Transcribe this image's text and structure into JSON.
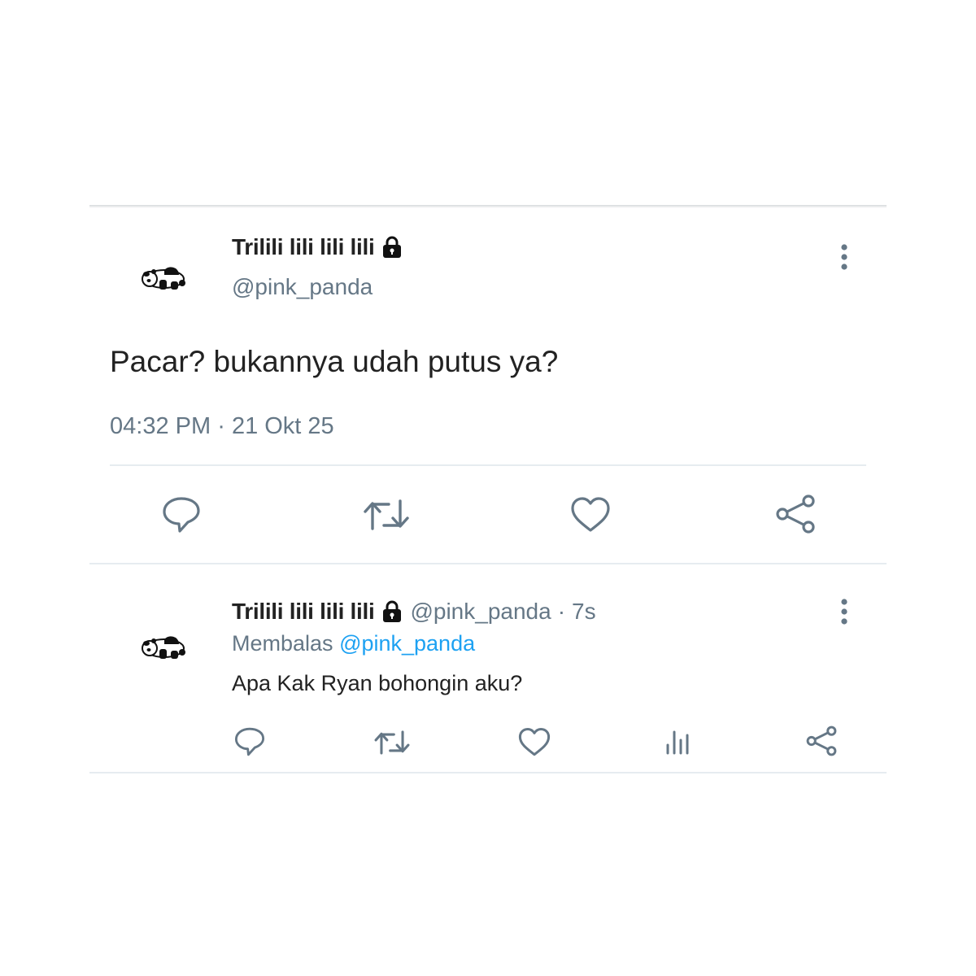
{
  "tweet": {
    "display_name": "Trilili lili lili lili",
    "handle": "@pink_panda",
    "text": "Pacar? bukannya udah putus ya?",
    "time": "04:32 PM",
    "separator": "·",
    "date": "21 Okt 25"
  },
  "reply": {
    "display_name": "Trilili lili lili lili",
    "handle": "@pink_panda",
    "separator": "·",
    "age": "7s",
    "replying_label": "Membalas",
    "replying_to": "@pink_panda",
    "text": "Apa Kak Ryan bohongin aku?"
  },
  "icons": {
    "lock": "lock-icon",
    "more": "more-vertical-icon",
    "reply": "reply-icon",
    "retweet": "retweet-icon",
    "like": "like-icon",
    "analytics": "analytics-icon",
    "share": "share-icon"
  },
  "colors": {
    "text": "#222222",
    "secondary": "#657786",
    "link": "#1da1f2",
    "divider": "#e6ecf0"
  }
}
